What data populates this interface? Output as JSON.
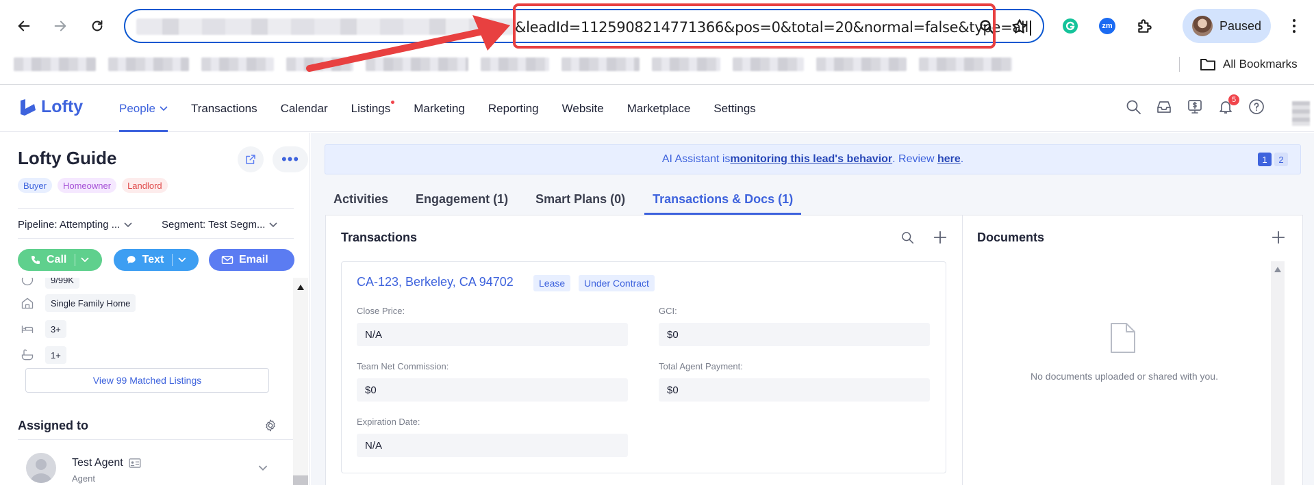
{
  "browser": {
    "url_visible": "&leadId=1125908214771366&pos=0&total=20&normal=false&type=all",
    "profile_label": "Paused",
    "all_bookmarks_label": "All Bookmarks",
    "extension_zm_label": "zm"
  },
  "header": {
    "logo_text": "Lofty",
    "menu": [
      {
        "label": "People",
        "active": true
      },
      {
        "label": "Transactions"
      },
      {
        "label": "Calendar"
      },
      {
        "label": "Listings",
        "dot": true
      },
      {
        "label": "Marketing"
      },
      {
        "label": "Reporting"
      },
      {
        "label": "Website"
      },
      {
        "label": "Marketplace"
      },
      {
        "label": "Settings"
      }
    ],
    "notification_count": "5"
  },
  "lead": {
    "name": "Lofty Guide",
    "tags": [
      "Buyer",
      "Homeowner",
      "Landlord"
    ],
    "pipeline": "Pipeline: Attempting ...",
    "segment": "Segment: Test Segm...",
    "actions": {
      "call": "Call",
      "text": "Text",
      "email": "Email"
    },
    "partial_chip": "9/99K",
    "property_type": "Single Family Home",
    "beds": "3+",
    "baths": "1+",
    "matched_listings": "View 99 Matched Listings",
    "assigned_title": "Assigned to",
    "agent_name": "Test Agent",
    "agent_role": "Agent"
  },
  "ai_bar": {
    "prefix": "AI Assistant is ",
    "link1": "monitoring this lead's behavior",
    "middle": ". Review ",
    "link2": "here",
    "suffix": ".",
    "pages": [
      "1",
      "2"
    ]
  },
  "tabs": [
    "Activities",
    "Engagement (1)",
    "Smart Plans (0)",
    "Transactions & Docs (1)"
  ],
  "transactions": {
    "title": "Transactions",
    "address": "CA-123, Berkeley, CA 94702",
    "badges": [
      "Lease",
      "Under Contract"
    ],
    "fields": {
      "close_price_label": "Close Price:",
      "close_price": "N/A",
      "gci_label": "GCI:",
      "gci": "$0",
      "team_net_label": "Team Net Commission:",
      "team_net": "$0",
      "total_agent_label": "Total Agent Payment:",
      "total_agent": "$0",
      "expiration_label": "Expiration Date:",
      "expiration": "N/A"
    }
  },
  "documents": {
    "title": "Documents",
    "empty_text": "No documents uploaded or shared with you."
  },
  "colors": {
    "accent": "#3e63dd",
    "annotation_red": "#e84040",
    "call_green": "#5fd08d",
    "text_blue": "#3d9ef2",
    "email_blue": "#5b7cf2"
  }
}
